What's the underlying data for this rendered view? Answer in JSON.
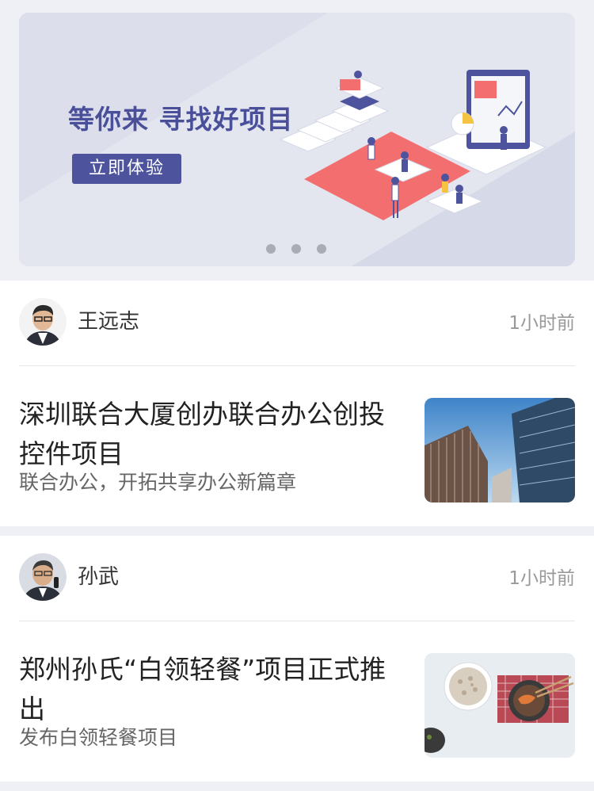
{
  "banner": {
    "title": "等你来 寻找好项目",
    "button_label": "立即体验",
    "dots_count": 3,
    "colors": {
      "background": "#e4e6f0",
      "title": "#4a4f9a",
      "button": "#4d549d",
      "accent": "#f36f6f"
    }
  },
  "feed": [
    {
      "author": "王远志",
      "time": "1小时前",
      "title": "深圳联合大厦创办联合办公创投控件项目",
      "subtitle": "联合办公，开拓共享办公新篇章",
      "thumbnail_icon": "skyscraper-photo"
    },
    {
      "author": "孙武",
      "time": "1小时前",
      "title": "郑州孙氏“白领轻餐”项目正式推出",
      "subtitle": "发布白领轻餐项目",
      "thumbnail_icon": "food-photo"
    }
  ]
}
